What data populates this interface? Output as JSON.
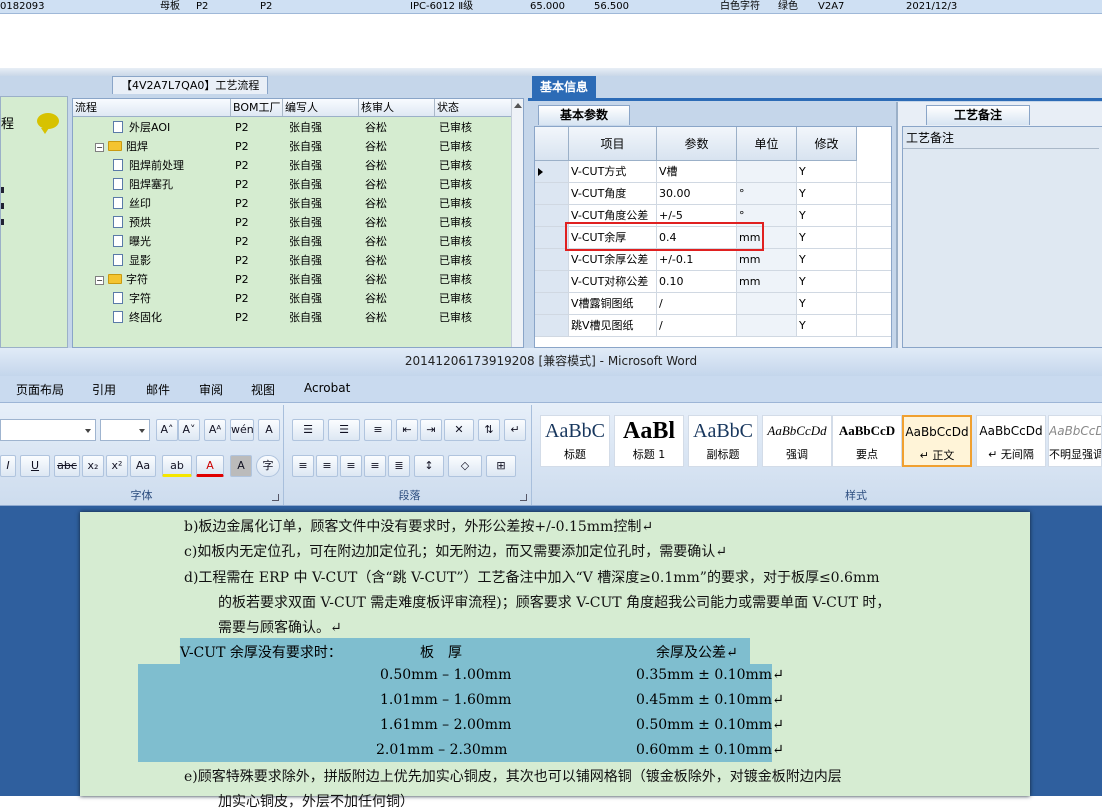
{
  "top_row": {
    "c0": "0182093",
    "c1": "母板",
    "c2": "P2",
    "c3": "P2",
    "c4": "IPC-6012 Ⅱ级",
    "c5": "65.000",
    "c6": "56.500",
    "c7": "白色字符",
    "c8": "绿色",
    "c9": "V2A7",
    "c10": "2021/12/3"
  },
  "process": {
    "tab_title": "【4V2A7L7QA0】工艺流程",
    "side_label": "程",
    "columns": [
      "流程",
      "BOM工厂",
      "编写人",
      "核审人",
      "状态"
    ],
    "rows": [
      {
        "type": "doc",
        "level": 2,
        "name": "外层AOI",
        "bom": "P2",
        "writer": "张自强",
        "reviewer": "谷松",
        "status": "已审核"
      },
      {
        "type": "folder",
        "level": 1,
        "name": "阻焊",
        "bom": "P2",
        "writer": "张自强",
        "reviewer": "谷松",
        "status": "已审核"
      },
      {
        "type": "doc",
        "level": 2,
        "name": "阻焊前处理",
        "bom": "P2",
        "writer": "张自强",
        "reviewer": "谷松",
        "status": "已审核"
      },
      {
        "type": "doc",
        "level": 2,
        "name": "阻焊塞孔",
        "bom": "P2",
        "writer": "张自强",
        "reviewer": "谷松",
        "status": "已审核"
      },
      {
        "type": "doc",
        "level": 2,
        "name": "丝印",
        "bom": "P2",
        "writer": "张自强",
        "reviewer": "谷松",
        "status": "已审核"
      },
      {
        "type": "doc",
        "level": 2,
        "name": "预烘",
        "bom": "P2",
        "writer": "张自强",
        "reviewer": "谷松",
        "status": "已审核"
      },
      {
        "type": "doc",
        "level": 2,
        "name": "曝光",
        "bom": "P2",
        "writer": "张自强",
        "reviewer": "谷松",
        "status": "已审核"
      },
      {
        "type": "doc",
        "level": 2,
        "name": "显影",
        "bom": "P2",
        "writer": "张自强",
        "reviewer": "谷松",
        "status": "已审核"
      },
      {
        "type": "folder",
        "level": 1,
        "name": "字符",
        "bom": "P2",
        "writer": "张自强",
        "reviewer": "谷松",
        "status": "已审核"
      },
      {
        "type": "doc",
        "level": 2,
        "name": "字符",
        "bom": "P2",
        "writer": "张自强",
        "reviewer": "谷松",
        "status": "已审核"
      },
      {
        "type": "doc",
        "level": 2,
        "name": "终固化",
        "bom": "P2",
        "writer": "张自强",
        "reviewer": "谷松",
        "status": "已审核"
      }
    ]
  },
  "basic_info": {
    "tab_label": "基本信息",
    "sub_tab": "基本参数",
    "columns": [
      "项目",
      "参数",
      "单位",
      "修改"
    ],
    "rows": [
      {
        "item": "V-CUT方式",
        "param": "V槽",
        "unit": "",
        "mod": "Y"
      },
      {
        "item": "V-CUT角度",
        "param": "30.00",
        "unit": "°",
        "mod": "Y"
      },
      {
        "item": "V-CUT角度公差",
        "param": "+/-5",
        "unit": "°",
        "mod": "Y"
      },
      {
        "item": "V-CUT余厚",
        "param": "0.4",
        "unit": "mm",
        "mod": "Y"
      },
      {
        "item": "V-CUT余厚公差",
        "param": "+/-0.1",
        "unit": "mm",
        "mod": "Y"
      },
      {
        "item": "V-CUT对称公差",
        "param": "0.10",
        "unit": "mm",
        "mod": "Y"
      },
      {
        "item": "V槽露铜图纸",
        "param": "/",
        "unit": "",
        "mod": "Y"
      },
      {
        "item": "跳V槽见图纸",
        "param": "/",
        "unit": "",
        "mod": "Y"
      }
    ]
  },
  "remarks": {
    "tab": "工艺备注",
    "header": "工艺备注"
  },
  "word": {
    "title": "20141206173919208 [兼容模式] - Microsoft Word",
    "tabs": [
      "页面布局",
      "引用",
      "邮件",
      "审阅",
      "视图",
      "Acrobat"
    ],
    "group_font": "字体",
    "group_para": "段落",
    "group_styles": "样式",
    "font_buttons": {
      "grow": "A˄",
      "shrink": "A˅",
      "clear": "Aᴬ",
      "phonetic": "wén",
      "border": "A",
      "italic": "I",
      "underline": "U",
      "strike": "abc",
      "sub": "x₂",
      "sup": "x²",
      "case": "Aa",
      "highlight": "ab",
      "color": "A",
      "shade": "A",
      "enclose": "字"
    },
    "styles": [
      {
        "preview": "AaBbC",
        "name": "标题"
      },
      {
        "preview": "AaBl",
        "name": "标题 1"
      },
      {
        "preview": "AaBbC",
        "name": "副标题"
      },
      {
        "preview": "AaBbCcDd",
        "name": "强调"
      },
      {
        "preview": "AaBbCcD",
        "name": "要点"
      },
      {
        "preview": "AaBbCcDd",
        "name": "↵ 正文"
      },
      {
        "preview": "AaBbCcDd",
        "name": "↵ 无间隔"
      },
      {
        "preview": "AaBbCcDd",
        "name": "不明显强调"
      }
    ]
  },
  "doc": {
    "b": "b)板边金属化订单，顾客文件中没有要求时，外形公差按+/-0.15mm控制↵",
    "c": "c)如板内无定位孔，可在附边加定位孔；如无附边，而又需要添加定位孔时，需要确认↵",
    "d1": "d)工程需在 ERP 中 V-CUT（含“跳 V-CUT”）工艺备注中加入“V 槽深度≥0.1mm”的要求，对于板厚≤0.6mm",
    "d2": "的板若要求双面 V-CUT 需走难度板评审流程)；顾客要求 V-CUT 角度超我公司能力或需要单面 V-CUT 时，",
    "d3": "需要与顾客确认。↵",
    "table_head": "V-CUT 余厚没有要求时：",
    "col1": "板　厚",
    "col2": "余厚及公差↵",
    "trows": [
      {
        "t": "0.50mm – 1.00mm",
        "r": "0.35mm ± 0.10mm↵"
      },
      {
        "t": "1.01mm – 1.60mm",
        "r": "0.45mm ± 0.10mm↵"
      },
      {
        "t": "1.61mm – 2.00mm",
        "r": "0.50mm ± 0.10mm↵"
      },
      {
        "t": "2.01mm – 2.30mm",
        "r": "0.60mm ± 0.10mm↵"
      }
    ],
    "e1": "e)顾客特殊要求除外，拼版附边上优先加实心铜皮，其次也可以铺网格铜（镀金板除外，对镀金板附边内层",
    "e2": "加实心铜皮，外层不加任何铜）"
  }
}
